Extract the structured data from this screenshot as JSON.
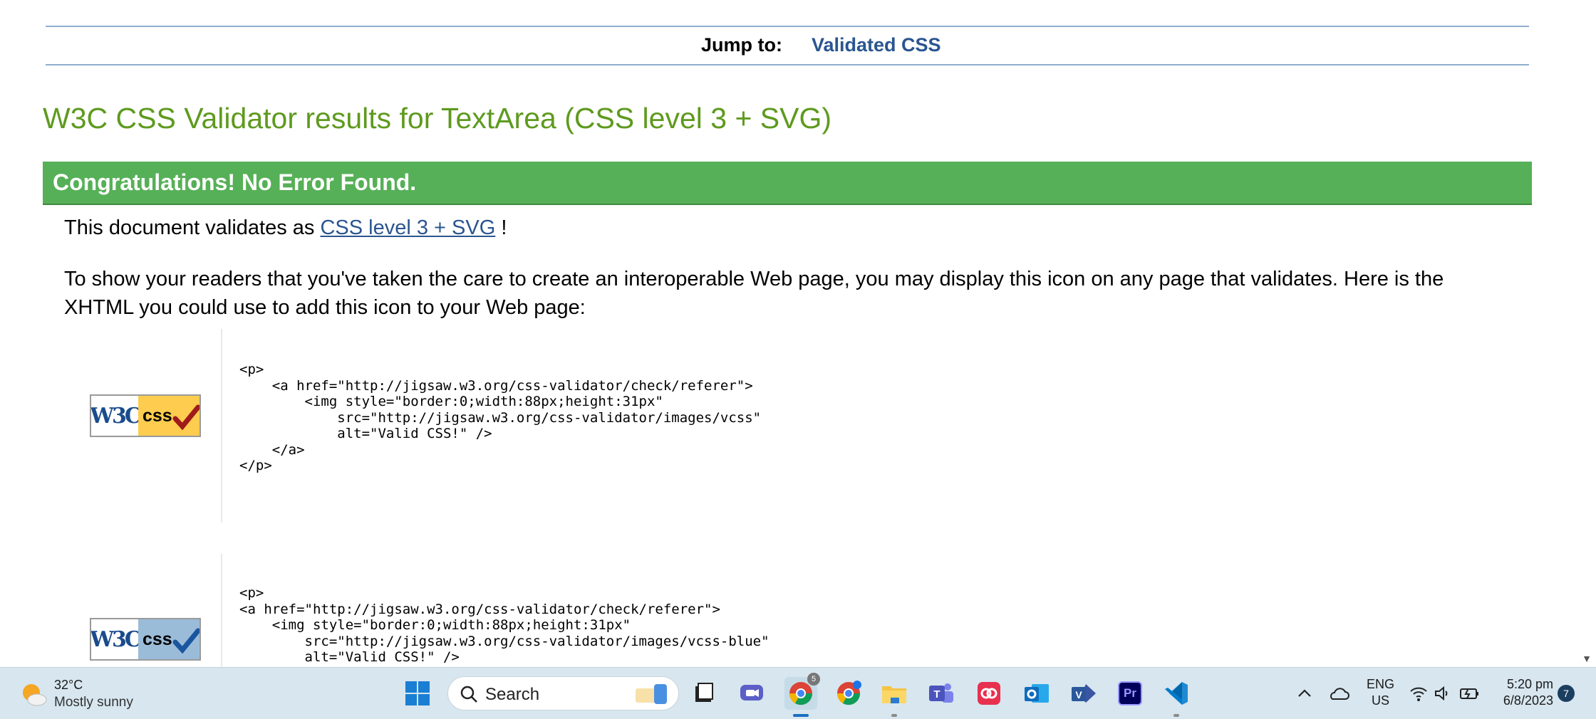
{
  "nav": {
    "jump_label": "Jump to:",
    "jump_link": "Validated CSS"
  },
  "page": {
    "title": "W3C CSS Validator results for TextArea (CSS level 3 + SVG)",
    "congrats": "Congratulations! No Error Found.",
    "validates_prefix": "This document validates as ",
    "validates_link": "CSS level 3 + SVG",
    "validates_suffix": " !",
    "info": "To show your readers that you've taken the care to create an interoperable Web page, you may display this icon on any page that validates. Here is the XHTML you could use to add this icon to your Web page:"
  },
  "badges": {
    "w3c_text": "W3C",
    "css_text": "css",
    "gold_color": "#fecc4f",
    "blue_color": "#9bbcd9"
  },
  "code_blocks": [
    "<p>\n    <a href=\"http://jigsaw.w3.org/css-validator/check/referer\">\n        <img style=\"border:0;width:88px;height:31px\"\n            src=\"http://jigsaw.w3.org/css-validator/images/vcss\"\n            alt=\"Valid CSS!\" />\n    </a>\n</p>",
    "<p>\n<a href=\"http://jigsaw.w3.org/css-validator/check/referer\">\n    <img style=\"border:0;width:88px;height:31px\"\n        src=\"http://jigsaw.w3.org/css-validator/images/vcss-blue\"\n        alt=\"Valid CSS!\" />"
  ],
  "taskbar": {
    "weather": {
      "temp": "32°C",
      "desc": "Mostly sunny",
      "icon": "sun-cloud-icon"
    },
    "search_label": "Search",
    "apps": [
      {
        "name": "windows-start-icon"
      },
      {
        "name": "file-explorer-icon"
      },
      {
        "name": "task-view-icon"
      },
      {
        "name": "chat-icon"
      },
      {
        "name": "chrome-icon",
        "badge": "5"
      },
      {
        "name": "chrome-canary-icon"
      },
      {
        "name": "folder-icon"
      },
      {
        "name": "teams-icon"
      },
      {
        "name": "creative-cloud-icon"
      },
      {
        "name": "outlook-icon"
      },
      {
        "name": "visio-icon"
      },
      {
        "name": "premiere-icon",
        "label": "Pr"
      },
      {
        "name": "vscode-icon"
      }
    ],
    "lang_line1": "ENG",
    "lang_line2": "US",
    "time": "5:20 pm",
    "date": "6/8/2023",
    "notification_count": "7"
  }
}
